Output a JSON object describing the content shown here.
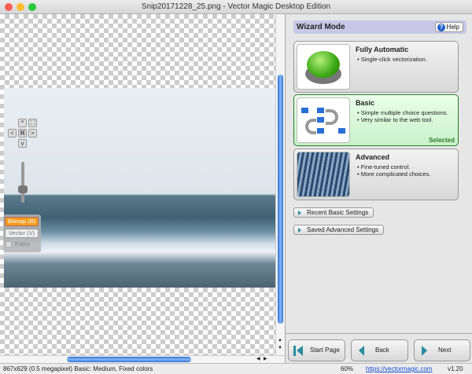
{
  "window": {
    "title": "Snip20171228_25.png - Vector Magic Desktop Edition"
  },
  "view_controls": {
    "up": "^",
    "down": "v",
    "left": "<",
    "right": ">",
    "center": "⌘",
    "fit": "⛶",
    "bitmap_label": "Bitmap (B)",
    "vector_label": "Vector (V)",
    "paths_label": "Paths",
    "zoom_slider_level": 0.2
  },
  "wizard": {
    "title": "Wizard Mode",
    "help_label": "Help",
    "modes": [
      {
        "title": "Fully Automatic",
        "bullets": [
          "Single-click vectorization."
        ]
      },
      {
        "title": "Basic",
        "bullets": [
          "Simple multiple choice questions.",
          "Very similar to the web tool."
        ],
        "status": "Selected"
      },
      {
        "title": "Advanced",
        "bullets": [
          "Fine-tuned control.",
          "More complicated choices."
        ]
      }
    ],
    "recent_basic": "Recent Basic Settings",
    "saved_advanced": "Saved Advanced Settings"
  },
  "nav": {
    "start": "Start Page",
    "back": "Back",
    "next": "Next"
  },
  "status": {
    "info": "867x629 (0.5 megapixel)  Basic: Medium, Fixed colors",
    "zoom": "60%",
    "link": "https://vectormagic.com",
    "version": "v1.20"
  },
  "colors": {
    "selected_green": "#2d7a2d",
    "bitmap_orange": "#f39a1a",
    "scroll_blue": "#2a6fd6"
  }
}
